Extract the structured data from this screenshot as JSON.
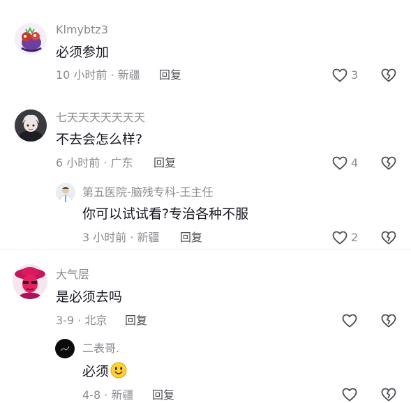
{
  "comments": [
    {
      "username": "Klmybtz3",
      "text": "必须参加",
      "meta": "10 小时前 · 新疆",
      "reply_label": "回复",
      "likes": "3"
    },
    {
      "username": "七天天天天天天天",
      "text": "不去会怎么样?",
      "meta": "6 小时前 · 广东",
      "reply_label": "回复",
      "likes": "4",
      "replies": [
        {
          "username": "第五医院-脑残专科-王主任",
          "text": "你可以试试看?专治各种不服",
          "meta": "3 小时前 · 新疆",
          "reply_label": "回复",
          "likes": "2"
        }
      ]
    },
    {
      "username": "大气层",
      "text": "是必须去吗",
      "meta": "3-9 · 北京",
      "reply_label": "回复",
      "likes": "",
      "replies": [
        {
          "username": "二表哥.",
          "text": "必须",
          "emoji": "smiling-face-emoji",
          "meta": "4-8 · 新疆",
          "reply_label": "回复",
          "likes": ""
        }
      ]
    }
  ],
  "colors": {
    "text": "#161823",
    "muted": "#8a8b91",
    "reply": "#4b4c52",
    "icon": "#4b4c52"
  }
}
